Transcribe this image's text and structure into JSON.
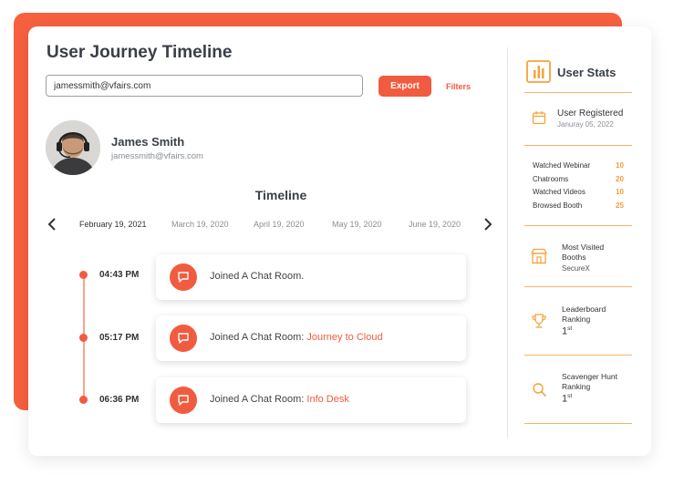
{
  "header": {
    "title": "User Journey Timeline"
  },
  "search": {
    "value": "jamessmith@vfairs.com"
  },
  "toolbar": {
    "export_label": "Export",
    "filters_label": "Filters"
  },
  "profile": {
    "name": "James Smith",
    "email": "jamessmith@vfairs.com"
  },
  "timeline": {
    "heading": "Timeline",
    "dates": [
      "February 19, 2021",
      "March 19, 2020",
      "April  19, 2020",
      "May  19, 2020",
      "June 19, 2020"
    ],
    "active_index": 0,
    "events": [
      {
        "time": "04:43 PM",
        "text": "Joined A Chat Room.",
        "link": ""
      },
      {
        "time": "05:17 PM",
        "text": "Joined A Chat Room: ",
        "link": "Journey to Cloud"
      },
      {
        "time": "06:36 PM",
        "text": "Joined A Chat Room: ",
        "link": "Info Desk"
      }
    ]
  },
  "stats": {
    "title": "User Stats",
    "registered_label": "User Registered",
    "registered_date": "Januray 05, 2022",
    "rows": [
      {
        "label": "Watched Webinar",
        "value": "10"
      },
      {
        "label": "Chatrooms",
        "value": "20"
      },
      {
        "label": "Watched Videos",
        "value": "10"
      },
      {
        "label": "Browsed Booth",
        "value": "25"
      }
    ],
    "most_visited_label_1": "Most Visited",
    "most_visited_label_2": "Booths",
    "most_visited_value": "SecureX",
    "leaderboard_label_1": "Leaderboard",
    "leaderboard_label_2": "Ranking",
    "leaderboard_rank": "1",
    "leaderboard_suffix": "st",
    "hunt_label_1": "Scavenger Hunt",
    "hunt_label_2": "Ranking",
    "hunt_rank": "1",
    "hunt_suffix": "st"
  },
  "colors": {
    "accent": "#f15b3f",
    "stat_value": "#f39c3c",
    "stat_icon": "#f6a23c"
  }
}
